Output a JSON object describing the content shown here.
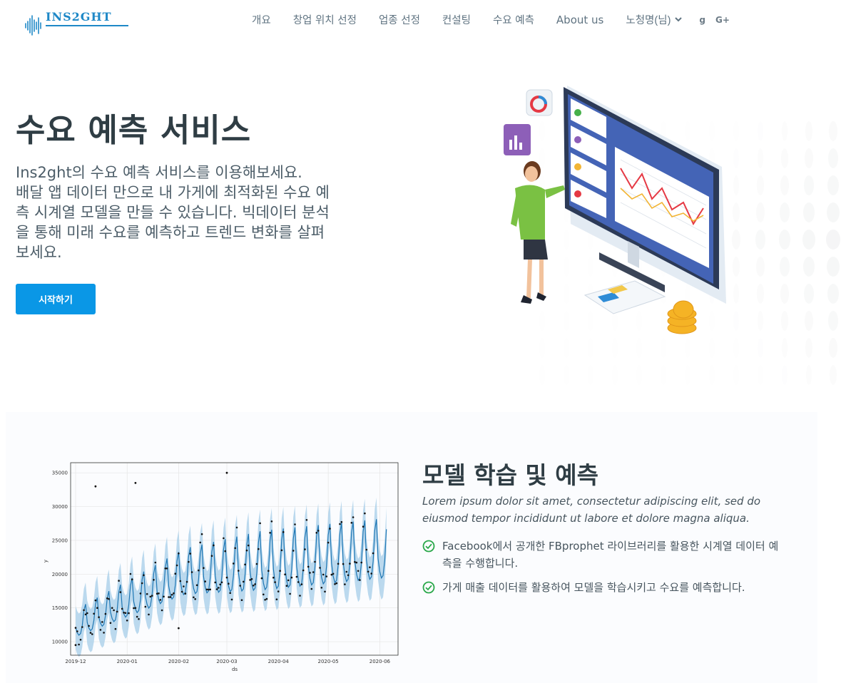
{
  "logo": {
    "text": "INS2GHT"
  },
  "nav": {
    "items": [
      {
        "label": "개요"
      },
      {
        "label": "창업 위치 선정"
      },
      {
        "label": "업종 선정"
      },
      {
        "label": "컨설팅"
      },
      {
        "label": "수요 예측"
      },
      {
        "label": "About us"
      }
    ],
    "user": "노청명(님)",
    "social": [
      {
        "icon": "google-icon",
        "label": "g"
      },
      {
        "icon": "google-plus-icon",
        "label": "G+"
      }
    ]
  },
  "hero": {
    "title": "수요 예측 서비스",
    "lines": [
      "Ins2ght의 수요 예측 서비스를 이용해보세요.",
      "배달 앱 데이터 만으로 내 가게에 최적화된 수요 예",
      "측 시계열 모델을 만들 수 있습니다. 빅데이터 분석",
      "을 통해 미래 수요를 예측하고 트렌드 변화를 살펴",
      "보세요."
    ],
    "cta": "시작하기"
  },
  "feature": {
    "title": "모델 학습 및 예측",
    "lorem": "Lorem ipsum dolor sit amet, consectetur adipiscing elit, sed do eiusmod tempor incididunt ut labore et dolore magna aliqua.",
    "bullets": [
      "Facebook에서 공개한 FBprophet 라이브러리를 활용한 시계열 데이터 예측을 수행합니다.",
      "가게 매출 데이터를 활용하여 모델을 학습시키고 수요를 예측합니다."
    ]
  },
  "colors": {
    "accent": "#0a97e6",
    "logo": "#1e88c7",
    "check": "#2aa84a",
    "forecast": "#1f77b4",
    "band": "#a6cde8"
  },
  "chart_data": {
    "type": "line",
    "xlabel": "ds",
    "ylabel": "y",
    "x_ticks": [
      "2019-12",
      "2020-01",
      "2020-02",
      "2020-03",
      "2020-04",
      "2020-05",
      "2020-06"
    ],
    "y_ticks": [
      "10000",
      "15000",
      "20000",
      "25000",
      "30000",
      "35000"
    ],
    "ylim": [
      8000,
      36500
    ],
    "grid": true,
    "start_date": "2019-12-01",
    "n_days": 188,
    "series": [
      {
        "name": "",
        "kind": "forecast",
        "trend_start": 13000,
        "trend_mid": 20000,
        "trend_end": 23000,
        "weekly_amplitude": 6500,
        "band_half_width": 3200
      },
      {
        "name": "",
        "kind": "observed-points"
      }
    ],
    "outliers": [
      {
        "x": "2019-12-13",
        "y": 33000
      },
      {
        "x": "2020-01-06",
        "y": 33500
      },
      {
        "x": "2020-02-01",
        "y": 12000
      },
      {
        "x": "2020-03-01",
        "y": 35000
      },
      {
        "x": "2019-12-01",
        "y": 9500
      }
    ]
  }
}
